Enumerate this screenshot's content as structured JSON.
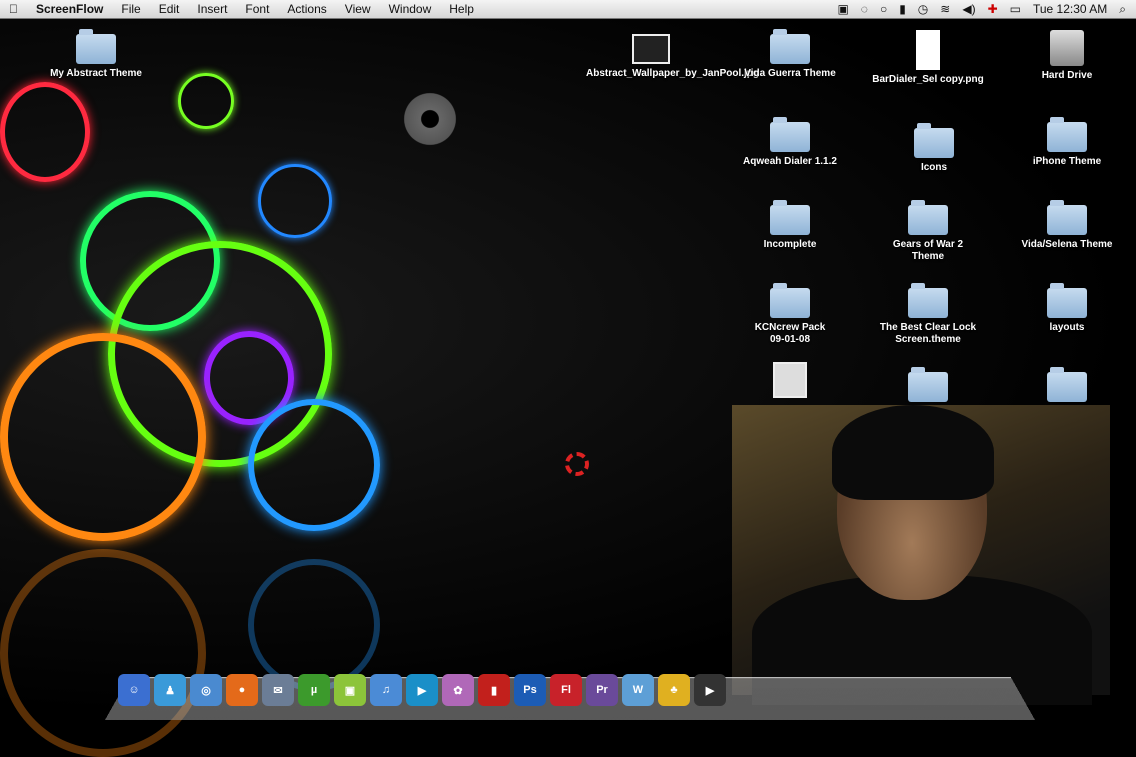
{
  "menubar": {
    "app": "ScreenFlow",
    "items": [
      "File",
      "Edit",
      "Insert",
      "Font",
      "Actions",
      "View",
      "Window",
      "Help"
    ],
    "clock": "Tue 12:30 AM"
  },
  "desktop": {
    "left_icon": "My Abstract Theme",
    "icons": [
      {
        "label": "Abstract_Wallpaper_by_JanPool.jpg",
        "kind": "image"
      },
      {
        "label": "Vida Guerra Theme",
        "kind": "folder"
      },
      {
        "label": "BarDialer_Sel copy.png",
        "kind": "image"
      },
      {
        "label": "Hard Drive",
        "kind": "drive"
      },
      {
        "label": "Aqweah Dialer 1.1.2",
        "kind": "folder"
      },
      {
        "label": "Icons",
        "kind": "folder"
      },
      {
        "label": "iPhone Theme",
        "kind": "folder"
      },
      {
        "label": "Incomplete",
        "kind": "folder"
      },
      {
        "label": "Gears of War 2 Theme",
        "kind": "folder"
      },
      {
        "label": "Vida/Selena Theme",
        "kind": "folder"
      },
      {
        "label": "KCNcrew Pack 09-01-08",
        "kind": "folder"
      },
      {
        "label": "The Best Clear Lock Screen.theme",
        "kind": "folder"
      },
      {
        "label": "layouts",
        "kind": "folder"
      }
    ]
  },
  "dock": [
    {
      "name": "finder",
      "glyph": "☺",
      "color": "#3b6fd1"
    },
    {
      "name": "messenger",
      "glyph": "♟",
      "color": "#3a9ad9"
    },
    {
      "name": "safari",
      "glyph": "◎",
      "color": "#4a8ad0"
    },
    {
      "name": "firefox",
      "glyph": "●",
      "color": "#e46a1a"
    },
    {
      "name": "mail",
      "glyph": "✉",
      "color": "#6b7d96"
    },
    {
      "name": "utorrent",
      "glyph": "µ",
      "color": "#3c9a2c"
    },
    {
      "name": "app",
      "glyph": "▣",
      "color": "#8cc43a"
    },
    {
      "name": "itunes",
      "glyph": "♫",
      "color": "#4b8bd6"
    },
    {
      "name": "quicktime",
      "glyph": "▶",
      "color": "#1a8fc8"
    },
    {
      "name": "video",
      "glyph": "✿",
      "color": "#b068b8"
    },
    {
      "name": "photobooth",
      "glyph": "▮",
      "color": "#c2201c"
    },
    {
      "name": "photoshop",
      "glyph": "Ps",
      "color": "#1c5cb5"
    },
    {
      "name": "flash",
      "glyph": "Fl",
      "color": "#c8222a"
    },
    {
      "name": "premiere",
      "glyph": "Pr",
      "color": "#6a4a9a"
    },
    {
      "name": "dreamweaver",
      "glyph": "W",
      "color": "#5d9fd6"
    },
    {
      "name": "adium",
      "glyph": "♣",
      "color": "#e0b020"
    },
    {
      "name": "screenflow",
      "glyph": "▶",
      "color": "#333"
    }
  ]
}
